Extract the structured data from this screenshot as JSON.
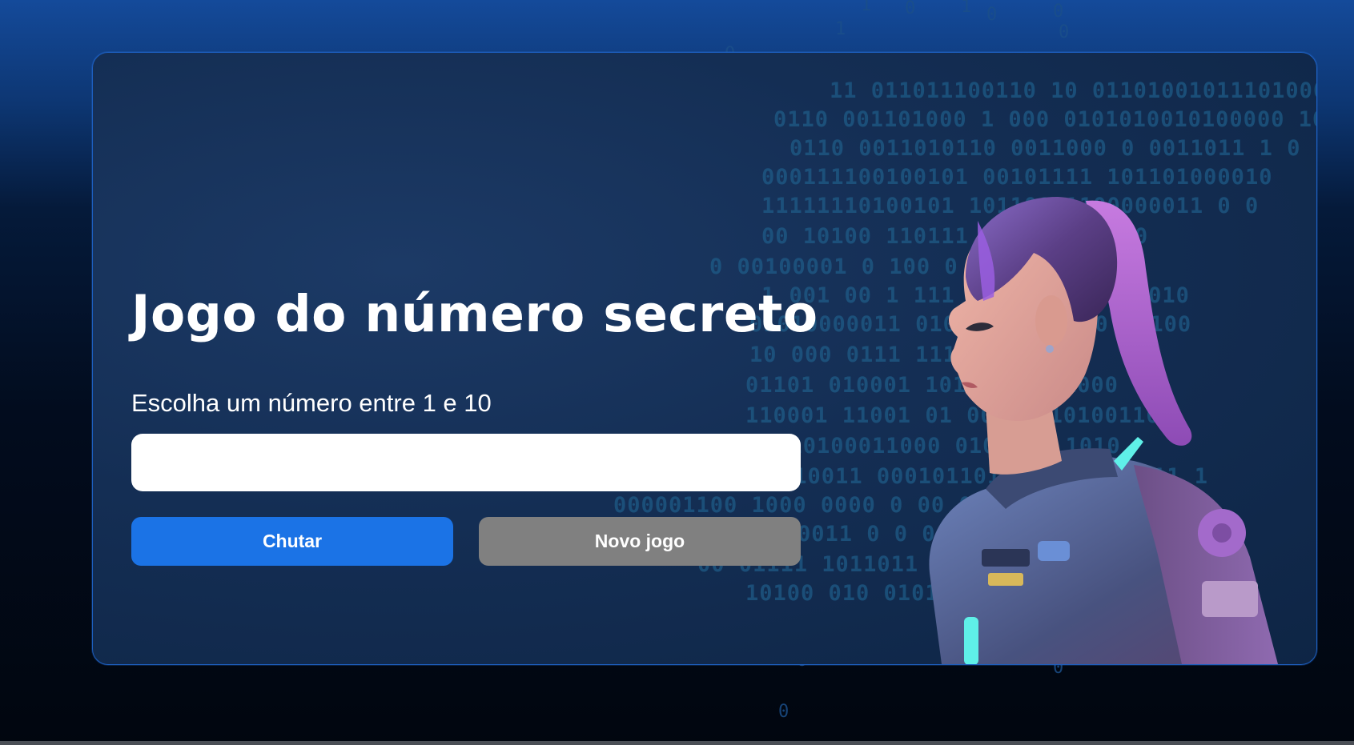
{
  "game": {
    "title": "Jogo do número secreto",
    "prompt": "Escolha um número entre 1 e 10",
    "input": {
      "value": "",
      "placeholder": ""
    },
    "buttons": {
      "guess": "Chutar",
      "new_game": "Novo jogo"
    }
  },
  "illustration": {
    "subject": "girl-in-space-suit-illustration"
  },
  "colors": {
    "primary_button": "#1b73e6",
    "secondary_button": "#808080",
    "card_border": "#1d5fbf",
    "title_text": "#ffffff"
  }
}
